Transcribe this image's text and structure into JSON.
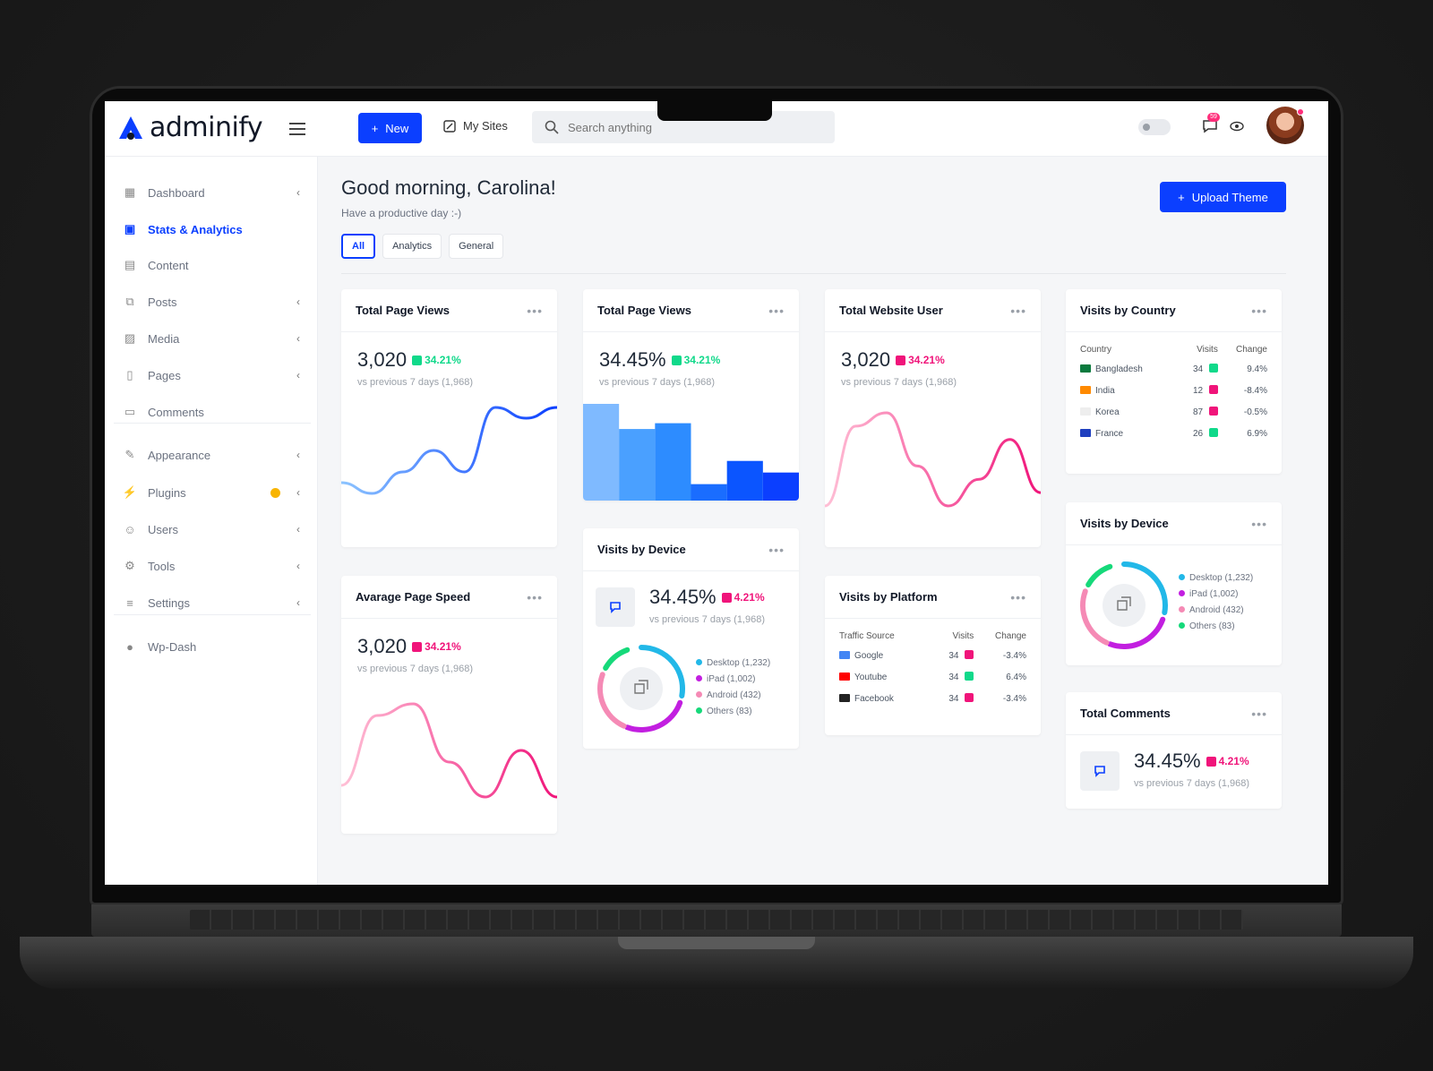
{
  "brand": {
    "name": "adminify"
  },
  "header": {
    "new_label": "New",
    "mysites_label": "My Sites",
    "search_placeholder": "Search anything",
    "notification_count": "59"
  },
  "sidebar": {
    "items": [
      {
        "label": "Dashboard",
        "icon": "grid-icon",
        "chevron": true
      },
      {
        "label": "Stats & Analytics",
        "icon": "chart-icon",
        "active": true
      },
      {
        "label": "Content",
        "icon": "database-icon"
      },
      {
        "label": "Posts",
        "icon": "posts-icon",
        "chevron": true
      },
      {
        "label": "Media",
        "icon": "image-icon",
        "chevron": true
      },
      {
        "label": "Pages",
        "icon": "page-icon",
        "chevron": true
      },
      {
        "label": "Comments",
        "icon": "comment-icon"
      },
      {
        "label": "Appearance",
        "icon": "brush-icon",
        "chevron": true
      },
      {
        "label": "Plugins",
        "icon": "plug-icon",
        "chevron": true
      },
      {
        "label": "Users",
        "icon": "users-icon",
        "chevron": true
      },
      {
        "label": "Tools",
        "icon": "tools-icon",
        "chevron": true
      },
      {
        "label": "Settings",
        "icon": "settings-icon",
        "chevron": true
      },
      {
        "label": "Wp-Dash",
        "icon": "wp-icon"
      }
    ]
  },
  "main": {
    "greeting": "Good morning, Carolina!",
    "subtitle": "Have a productive day :-)",
    "upload_label": "Upload Theme",
    "tabs": [
      "All",
      "Analytics",
      "General"
    ]
  },
  "colors": {
    "primary": "#0b3fff",
    "up": "#10d98a",
    "down": "#f0147a"
  },
  "cards": {
    "page_views_1": {
      "title": "Total Page Views",
      "value": "3,020",
      "change": "34.21%",
      "vs": "vs previous 7 days (1,968)"
    },
    "page_views_2": {
      "title": "Total Page Views",
      "value": "34.45%",
      "change": "34.21%",
      "vs": "vs previous 7 days (1,968)"
    },
    "website_user": {
      "title": "Total Website User",
      "value": "3,020",
      "change": "34.21%",
      "vs": "vs previous 7 days (1,968)"
    },
    "page_speed": {
      "title": "Avarage Page Speed",
      "value": "3,020",
      "change": "34.21%",
      "vs": "vs previous 7 days (1,968)"
    },
    "device_mid": {
      "title": "Visits by Device",
      "value": "34.45%",
      "change": "4.21%",
      "vs": "vs previous 7 days (1,968)"
    },
    "device_right": {
      "title": "Visits by Device"
    },
    "comments": {
      "title": "Total Comments",
      "value": "34.45%",
      "change": "4.21%",
      "vs": "vs previous 7 days (1,968)"
    },
    "country": {
      "title": "Visits by Country",
      "headers": [
        "Country",
        "Visits",
        "Change"
      ],
      "rows": [
        {
          "name": "Bangladesh",
          "visits": "34",
          "change": "9.4%",
          "dir": "up"
        },
        {
          "name": "India",
          "visits": "12",
          "change": "-8.4%",
          "dir": "down"
        },
        {
          "name": "Korea",
          "visits": "87",
          "change": "-0.5%",
          "dir": "down"
        },
        {
          "name": "France",
          "visits": "26",
          "change": "6.9%",
          "dir": "up"
        }
      ]
    },
    "platform": {
      "title": "Visits by Platform",
      "headers": [
        "Traffic Source",
        "Visits",
        "Change"
      ],
      "rows": [
        {
          "name": "Google",
          "visits": "34",
          "change": "-3.4%",
          "dir": "down"
        },
        {
          "name": "Youtube",
          "visits": "34",
          "change": "6.4%",
          "dir": "up"
        },
        {
          "name": "Facebook",
          "visits": "34",
          "change": "-3.4%",
          "dir": "down"
        }
      ]
    }
  },
  "device_legend": [
    {
      "label": "Desktop (1,232)",
      "color": "#22b8e8"
    },
    {
      "label": "iPad (1,002)",
      "color": "#c21fe0"
    },
    {
      "label": "Android (432)",
      "color": "#f58ab5"
    },
    {
      "label": "Others (83)",
      "color": "#16d97a"
    }
  ],
  "chart_data": [
    {
      "type": "line",
      "name": "page_views_1",
      "y": [
        2,
        1,
        3,
        5,
        3,
        9,
        8,
        9
      ]
    },
    {
      "type": "bar",
      "name": "page_views_2",
      "values": [
        100,
        74,
        80,
        17,
        41,
        29
      ]
    },
    {
      "type": "line",
      "name": "website_user",
      "y": [
        1,
        7,
        8,
        4,
        1,
        3,
        6,
        2
      ]
    },
    {
      "type": "line",
      "name": "page_speed",
      "y": [
        2,
        8,
        9,
        4,
        1,
        5,
        1
      ]
    },
    {
      "type": "pie",
      "name": "visits_by_device",
      "values": [
        1232,
        1002,
        432,
        83
      ],
      "labels": [
        "Desktop",
        "iPad",
        "Android",
        "Others"
      ]
    }
  ]
}
